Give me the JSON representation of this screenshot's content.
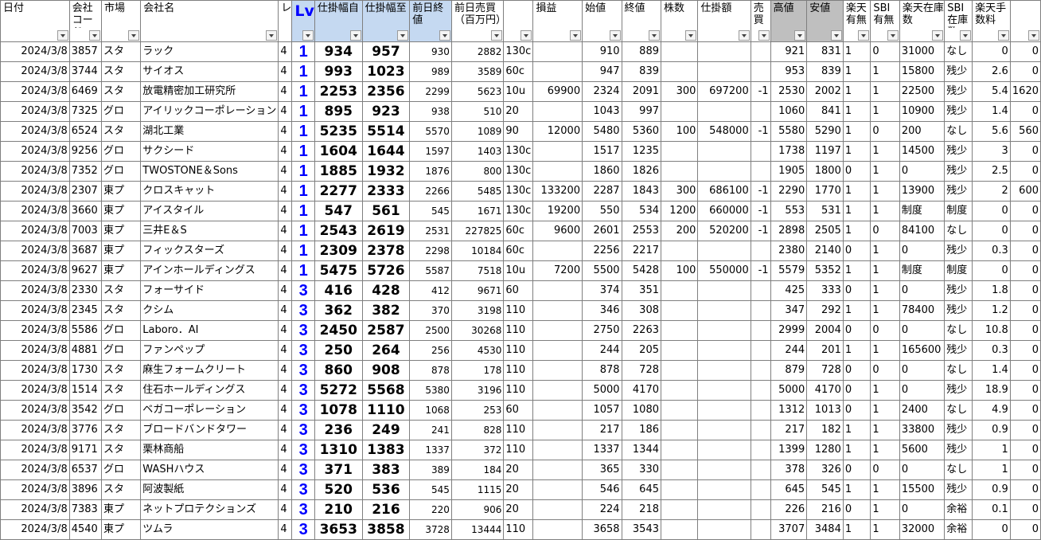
{
  "headers": [
    "日付",
    "会社コード",
    "市場",
    "会社名",
    "レ",
    "Lv",
    "仕掛幅自",
    "仕掛幅至",
    "前日終値",
    "前日売買（百万円）",
    "",
    "損益",
    "始値",
    "終値",
    "株数",
    "仕掛額",
    "売買",
    "高値",
    "安値",
    "楽天有無",
    "SBI有無",
    "楽天在庫数",
    "SBI在庫数",
    "楽天手数料",
    ""
  ],
  "rows": [
    [
      "2024/3/8",
      "3857",
      "スタ",
      "ラック",
      "4",
      "1",
      "934",
      "957",
      "930",
      "2882",
      "130c",
      "",
      "910",
      "889",
      "",
      "",
      "",
      "921",
      "831",
      "1",
      "0",
      "31000",
      "なし",
      "0",
      "0"
    ],
    [
      "2024/3/8",
      "3744",
      "スタ",
      "サイオス",
      "4",
      "1",
      "993",
      "1023",
      "989",
      "3589",
      "60c",
      "",
      "947",
      "839",
      "",
      "",
      "",
      "953",
      "839",
      "1",
      "1",
      "15800",
      "残少",
      "2.6",
      "0"
    ],
    [
      "2024/3/8",
      "6469",
      "スタ",
      "放電精密加工研究所",
      "4",
      "1",
      "2253",
      "2356",
      "2299",
      "5623",
      "10u",
      "69900",
      "2324",
      "2091",
      "300",
      "697200",
      "-1",
      "2530",
      "2002",
      "1",
      "1",
      "22500",
      "残少",
      "5.4",
      "1620"
    ],
    [
      "2024/3/8",
      "7325",
      "グロ",
      "アイリックコーポレーション",
      "4",
      "1",
      "895",
      "923",
      "938",
      "510",
      "20",
      "",
      "1043",
      "997",
      "",
      "",
      "",
      "1060",
      "841",
      "1",
      "1",
      "10900",
      "残少",
      "1.4",
      "0"
    ],
    [
      "2024/3/8",
      "6524",
      "スタ",
      "湖北工業",
      "4",
      "1",
      "5235",
      "5514",
      "5570",
      "1089",
      "90",
      "12000",
      "5480",
      "5360",
      "100",
      "548000",
      "-1",
      "5580",
      "5290",
      "1",
      "0",
      "200",
      "なし",
      "5.6",
      "560"
    ],
    [
      "2024/3/8",
      "9256",
      "グロ",
      "サクシード",
      "4",
      "1",
      "1604",
      "1644",
      "1597",
      "1403",
      "130c",
      "",
      "1517",
      "1235",
      "",
      "",
      "",
      "1738",
      "1197",
      "1",
      "1",
      "14500",
      "残少",
      "3",
      "0"
    ],
    [
      "2024/3/8",
      "7352",
      "グロ",
      "TWOSTONE＆Sons",
      "4",
      "1",
      "1885",
      "1932",
      "1876",
      "800",
      "130c",
      "",
      "1860",
      "1826",
      "",
      "",
      "",
      "1905",
      "1800",
      "0",
      "1",
      "0",
      "残少",
      "2.5",
      "0"
    ],
    [
      "2024/3/8",
      "2307",
      "東プ",
      "クロスキャット",
      "4",
      "1",
      "2277",
      "2333",
      "2266",
      "5485",
      "130c",
      "133200",
      "2287",
      "1843",
      "300",
      "686100",
      "-1",
      "2290",
      "1770",
      "1",
      "1",
      "13900",
      "残少",
      "2",
      "600"
    ],
    [
      "2024/3/8",
      "3660",
      "東プ",
      "アイスタイル",
      "4",
      "1",
      "547",
      "561",
      "545",
      "1671",
      "130c",
      "19200",
      "550",
      "534",
      "1200",
      "660000",
      "-1",
      "553",
      "531",
      "1",
      "1",
      "制度",
      "制度",
      "0",
      "0"
    ],
    [
      "2024/3/8",
      "7003",
      "東プ",
      "三井E＆S",
      "4",
      "1",
      "2543",
      "2619",
      "2531",
      "227825",
      "60c",
      "9600",
      "2601",
      "2553",
      "200",
      "520200",
      "-1",
      "2898",
      "2505",
      "1",
      "0",
      "84100",
      "なし",
      "0",
      "0"
    ],
    [
      "2024/3/8",
      "3687",
      "東プ",
      "フィックスターズ",
      "4",
      "1",
      "2309",
      "2378",
      "2298",
      "10184",
      "60c",
      "",
      "2256",
      "2217",
      "",
      "",
      "",
      "2380",
      "2140",
      "0",
      "1",
      "0",
      "残少",
      "0.3",
      "0"
    ],
    [
      "2024/3/8",
      "9627",
      "東プ",
      "アインホールディングス",
      "4",
      "1",
      "5475",
      "5726",
      "5587",
      "7518",
      "10u",
      "7200",
      "5500",
      "5428",
      "100",
      "550000",
      "-1",
      "5579",
      "5352",
      "1",
      "1",
      "制度",
      "制度",
      "0",
      "0"
    ],
    [
      "2024/3/8",
      "2330",
      "スタ",
      "フォーサイド",
      "4",
      "3",
      "416",
      "428",
      "412",
      "9671",
      "60",
      "",
      "374",
      "351",
      "",
      "",
      "",
      "425",
      "333",
      "0",
      "1",
      "0",
      "残少",
      "1.8",
      "0"
    ],
    [
      "2024/3/8",
      "2345",
      "スタ",
      "クシム",
      "4",
      "3",
      "362",
      "382",
      "370",
      "3198",
      "110",
      "",
      "346",
      "308",
      "",
      "",
      "",
      "347",
      "292",
      "1",
      "1",
      "78400",
      "残少",
      "1.2",
      "0"
    ],
    [
      "2024/3/8",
      "5586",
      "グロ",
      "Laboro．AI",
      "4",
      "3",
      "2450",
      "2587",
      "2500",
      "30268",
      "110",
      "",
      "2750",
      "2263",
      "",
      "",
      "",
      "2999",
      "2004",
      "0",
      "0",
      "0",
      "なし",
      "10.8",
      "0"
    ],
    [
      "2024/3/8",
      "4881",
      "グロ",
      "ファンペップ",
      "4",
      "3",
      "250",
      "264",
      "256",
      "4530",
      "110",
      "",
      "244",
      "205",
      "",
      "",
      "",
      "244",
      "201",
      "1",
      "1",
      "165600",
      "残少",
      "0.3",
      "0"
    ],
    [
      "2024/3/8",
      "1730",
      "スタ",
      "麻生フォームクリート",
      "4",
      "3",
      "860",
      "908",
      "878",
      "178",
      "110",
      "",
      "878",
      "728",
      "",
      "",
      "",
      "879",
      "728",
      "0",
      "0",
      "0",
      "なし",
      "1.4",
      "0"
    ],
    [
      "2024/3/8",
      "1514",
      "スタ",
      "住石ホールディングス",
      "4",
      "3",
      "5272",
      "5568",
      "5380",
      "3196",
      "110",
      "",
      "5000",
      "4170",
      "",
      "",
      "",
      "5000",
      "4170",
      "0",
      "1",
      "0",
      "残少",
      "18.9",
      "0"
    ],
    [
      "2024/3/8",
      "3542",
      "グロ",
      "ベガコーポレーション",
      "4",
      "3",
      "1078",
      "1110",
      "1068",
      "253",
      "60",
      "",
      "1057",
      "1080",
      "",
      "",
      "",
      "1312",
      "1013",
      "0",
      "1",
      "2400",
      "なし",
      "4.9",
      "0"
    ],
    [
      "2024/3/8",
      "3776",
      "スタ",
      "ブロードバンドタワー",
      "4",
      "3",
      "236",
      "249",
      "241",
      "828",
      "110",
      "",
      "217",
      "186",
      "",
      "",
      "",
      "217",
      "182",
      "1",
      "1",
      "33800",
      "残少",
      "0.9",
      "0"
    ],
    [
      "2024/3/8",
      "9171",
      "スタ",
      "栗林商船",
      "4",
      "3",
      "1310",
      "1383",
      "1337",
      "372",
      "110",
      "",
      "1337",
      "1344",
      "",
      "",
      "",
      "1399",
      "1280",
      "1",
      "1",
      "5600",
      "残少",
      "1",
      "0"
    ],
    [
      "2024/3/8",
      "6537",
      "グロ",
      "WASHハウス",
      "4",
      "3",
      "371",
      "383",
      "389",
      "184",
      "20",
      "",
      "365",
      "330",
      "",
      "",
      "",
      "378",
      "326",
      "0",
      "0",
      "0",
      "なし",
      "1",
      "0"
    ],
    [
      "2024/3/8",
      "3896",
      "スタ",
      "阿波製紙",
      "4",
      "3",
      "520",
      "536",
      "545",
      "1115",
      "20",
      "",
      "546",
      "645",
      "",
      "",
      "",
      "645",
      "545",
      "1",
      "1",
      "15500",
      "残少",
      "0.9",
      "0"
    ],
    [
      "2024/3/8",
      "7383",
      "東プ",
      "ネットプロテクションズ",
      "4",
      "3",
      "210",
      "216",
      "220",
      "906",
      "20",
      "",
      "224",
      "218",
      "",
      "",
      "",
      "226",
      "216",
      "0",
      "1",
      "0",
      "余裕",
      "0.1",
      "0"
    ],
    [
      "2024/3/8",
      "4540",
      "東プ",
      "ツムラ",
      "4",
      "3",
      "3653",
      "3858",
      "3728",
      "13444",
      "110",
      "",
      "3658",
      "3543",
      "",
      "",
      "",
      "3707",
      "3484",
      "1",
      "1",
      "32000",
      "余裕",
      "0",
      "0"
    ]
  ]
}
